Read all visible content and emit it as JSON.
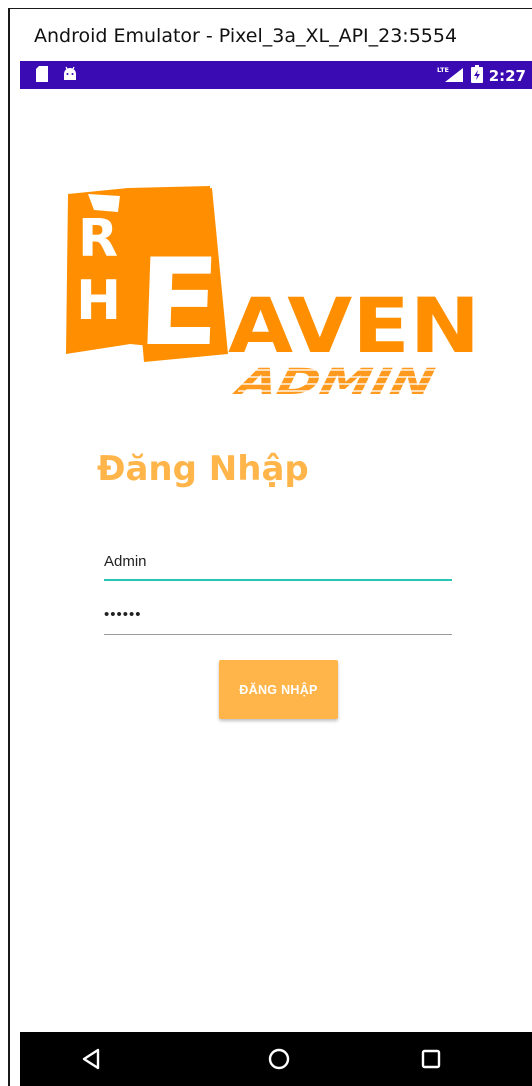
{
  "window": {
    "title": "Android Emulator - Pixel_3a_XL_API_23:5554"
  },
  "status_bar": {
    "time": "2:27",
    "network": "LTE",
    "left_icons": [
      "sd-card-icon",
      "android-icon"
    ],
    "right_icons": [
      "lte-signal-icon",
      "battery-icon"
    ],
    "background": "#3a0ab3"
  },
  "logo": {
    "letters_r_h": [
      "R",
      "H"
    ],
    "big_e": "E",
    "brand_suffix": "AVEN",
    "subtitle": "ADMIN",
    "color": "#ff8f00"
  },
  "login": {
    "heading": "Đăng Nhập",
    "username_value": "Admin",
    "password_value": "••••••",
    "button_label": "ĐĂNG NHẬP",
    "accent": "#ffb54a",
    "focus_underline": "#26c6b4"
  },
  "nav_bar": {
    "icons": [
      "back-icon",
      "home-icon",
      "recent-apps-icon"
    ]
  }
}
